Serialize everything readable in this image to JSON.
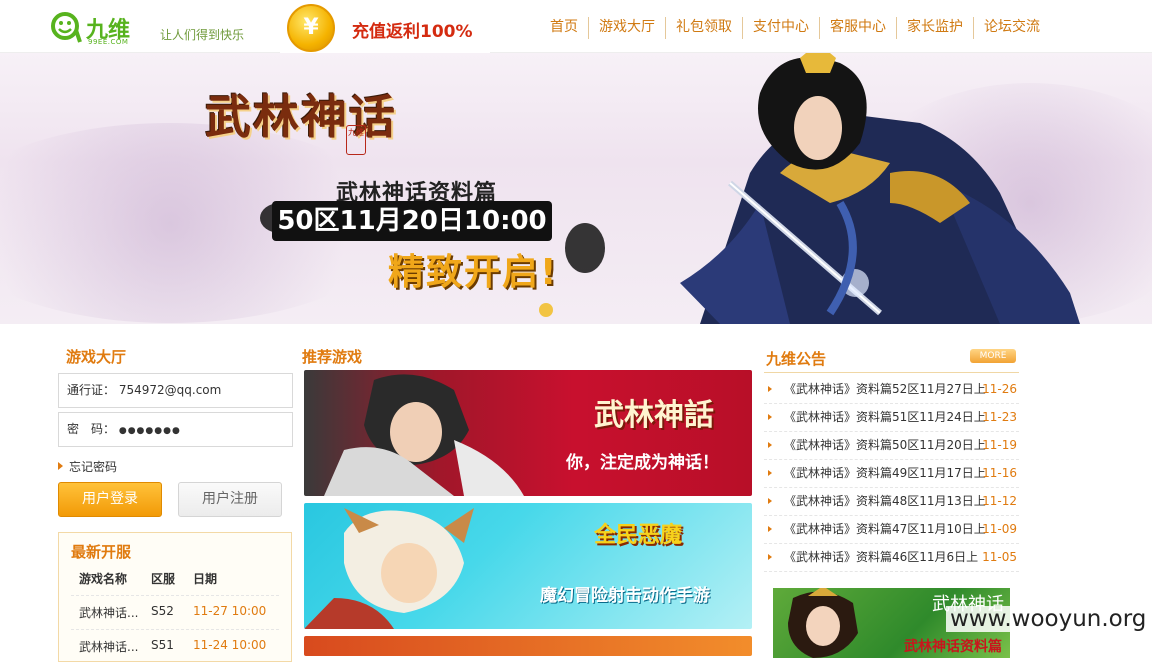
{
  "header": {
    "logo_text": "九维",
    "logo_sub": "99EE.COM",
    "slogan": "让人们得到快乐",
    "coin_symbol": "¥",
    "promo": "充值返利100%",
    "nav": [
      "首页",
      "游戏大厅",
      "礼包领取",
      "支付中心",
      "客服中心",
      "家长监护",
      "论坛交流"
    ]
  },
  "banner": {
    "game_title": "武林神话",
    "seal": "九维",
    "subtitle": "武林神话资料篇",
    "date": "50区11月20日10:00",
    "open": "精致开启!"
  },
  "login": {
    "section_title": "游戏大厅",
    "account_label": "通行证：",
    "account_value": "754972@qq.com",
    "password_label": "密　码：",
    "password_value": "●●●●●●●",
    "forgot": "忘记密码",
    "login_button": "用户登录",
    "register_button": "用户注册"
  },
  "servers": {
    "title": "最新开服",
    "headers": [
      "游戏名称",
      "区服",
      "日期"
    ],
    "rows": [
      [
        "武林神话...",
        "S52",
        "11-27 10:00"
      ],
      [
        "武林神话...",
        "S51",
        "11-24 10:00"
      ]
    ]
  },
  "recommend": {
    "section_title": "推荐游戏",
    "cards": [
      {
        "logo": "武林神話",
        "tagline": "你，注定成为神话！"
      },
      {
        "logo": "全民恶魔",
        "tagline": "魔幻冒险射击动作手游"
      }
    ]
  },
  "notice": {
    "title": "九维公告",
    "more": "MORE",
    "items": [
      {
        "title": "《武林神话》资料篇52区11月27日上",
        "date": "11-26"
      },
      {
        "title": "《武林神话》资料篇51区11月24日上",
        "date": "11-23"
      },
      {
        "title": "《武林神话》资料篇50区11月20日上",
        "date": "11-19"
      },
      {
        "title": "《武林神话》资料篇49区11月17日上",
        "date": "11-16"
      },
      {
        "title": "《武林神话》资料篇48区11月13日上",
        "date": "11-12"
      },
      {
        "title": "《武林神话》资料篇47区11月10日上",
        "date": "11-09"
      },
      {
        "title": "《武林神话》资料篇46区11月6日上",
        "date": "11-05"
      }
    ]
  },
  "ad": {
    "title": "武林神话",
    "subtitle": "武林神话资料篇"
  },
  "watermark": "www.wooyun.org"
}
